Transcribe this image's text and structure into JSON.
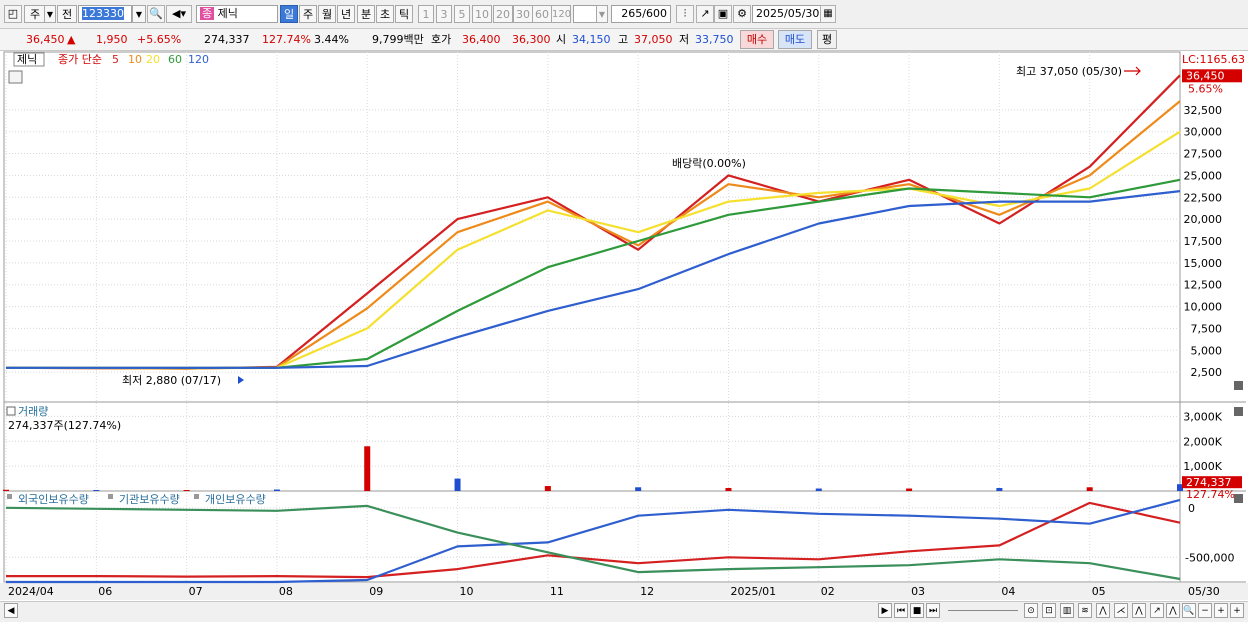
{
  "toolbar": {
    "market_label": "주",
    "prev_label": "전",
    "code": "123330",
    "name_badge": "종",
    "name": "제닉",
    "periods": [
      "일",
      "주",
      "월",
      "년",
      "분",
      "초",
      "틱"
    ],
    "selected_period": "일",
    "intervals": [
      "1",
      "3",
      "5",
      "10",
      "20",
      "30",
      "60",
      "120"
    ],
    "count": "265",
    "count_total": "/600",
    "date": "2025/05/30"
  },
  "quote": {
    "price": "36,450",
    "change": "1,950",
    "change_pct": "+5.65%",
    "volume": "274,337",
    "volume_pct": "127.74%",
    "turnover": "3.44%",
    "amount": "9,799백만",
    "ask_label": "호가",
    "ask": "36,400",
    "bid": "36,300",
    "open_label": "시",
    "open": "34,150",
    "high_label": "고",
    "high": "37,050",
    "low_label": "저",
    "low": "33,750",
    "buy_label": "매수",
    "sell_label": "매도",
    "eval_label": "평"
  },
  "colors": {
    "up": "#d40000",
    "down": "#1f4fd0",
    "ma5": "#d42020",
    "ma10": "#ee8a1a",
    "ma20": "#f5e030",
    "ma60": "#2e9a3a",
    "ma120": "#2f5fcf",
    "foreign": "#d42020",
    "inst": "#2f5fcf",
    "indiv": "#3a8f5a"
  },
  "price_panel": {
    "legend_name": "제닉",
    "legend_type": "종가 단순",
    "legend_periods": [
      "5",
      "10",
      "20",
      "60",
      "120"
    ],
    "lc_label": "LC:1165.63",
    "last_price_label": "36,450",
    "last_pct_label": "5.65%",
    "high_annotation": "최고 37,050 (05/30)",
    "low_annotation": "최저 2,880 (07/17)",
    "dividend_annotation": "배당락(0.00%)",
    "yticks": [
      "32,500",
      "30,000",
      "27,500",
      "25,000",
      "22,500",
      "20,000",
      "17,500",
      "15,000",
      "12,500",
      "10,000",
      "7,500",
      "5,000",
      "2,500"
    ]
  },
  "volume_panel": {
    "title": "거래량",
    "value_label": "274,337주(127.74%)",
    "last_label": "274,337",
    "last_pct": "127.74%",
    "yticks": [
      "3,000K",
      "2,000K",
      "1,000K"
    ]
  },
  "holdings_panel": {
    "legends": [
      "외국인보유수량",
      "기관보유수량",
      "개인보유수량"
    ],
    "yticks": [
      "0",
      "-500,000"
    ]
  },
  "xaxis": {
    "labels": [
      "2024/04",
      "06",
      "07",
      "08",
      "09",
      "10",
      "11",
      "12",
      "2025/01",
      "02",
      "03",
      "04",
      "05"
    ],
    "last_label": "05/30"
  },
  "chart_data": [
    {
      "type": "line",
      "title": "제닉",
      "ylim": [
        0,
        39000
      ],
      "x": [
        "2024/04",
        "06",
        "07",
        "08",
        "09",
        "10",
        "11",
        "12",
        "2025/01",
        "02",
        "03",
        "04",
        "05",
        "05/30"
      ],
      "series": [
        {
          "name": "5",
          "values": [
            3000,
            2950,
            2900,
            3100,
            11500,
            20000,
            22500,
            16500,
            25000,
            22000,
            24500,
            19500,
            26000,
            36450
          ]
        },
        {
          "name": "10",
          "values": [
            3000,
            2950,
            2920,
            3050,
            9800,
            18500,
            22000,
            17000,
            24000,
            22500,
            24000,
            20500,
            25000,
            33500
          ]
        },
        {
          "name": "20",
          "values": [
            3000,
            2980,
            2950,
            3000,
            7500,
            16500,
            21000,
            18500,
            22000,
            23000,
            23500,
            21500,
            23500,
            30000
          ]
        },
        {
          "name": "60",
          "values": [
            3000,
            3000,
            2980,
            3000,
            4000,
            9500,
            14500,
            17500,
            20500,
            22000,
            23500,
            23000,
            22500,
            24500
          ]
        },
        {
          "name": "120",
          "values": [
            3000,
            3000,
            3000,
            3000,
            3200,
            6500,
            9500,
            12000,
            16000,
            19500,
            21500,
            22000,
            22000,
            23200
          ]
        }
      ],
      "annotations": [
        "최고 37,050 (05/30)",
        "최저 2,880 (07/17)",
        "배당락(0.00%)"
      ]
    },
    {
      "type": "bar",
      "title": "거래량",
      "ylim": [
        0,
        3500
      ],
      "x": [
        "2024/04",
        "06",
        "07",
        "08",
        "09",
        "10",
        "11",
        "12",
        "2025/01",
        "02",
        "03",
        "04",
        "05",
        "05/30"
      ],
      "values": [
        50,
        40,
        40,
        60,
        1800,
        500,
        200,
        150,
        120,
        100,
        100,
        120,
        150,
        274
      ]
    },
    {
      "type": "line",
      "ylim": [
        -750000,
        150000
      ],
      "x": [
        "2024/04",
        "06",
        "07",
        "08",
        "09",
        "10",
        "11",
        "12",
        "2025/01",
        "02",
        "03",
        "04",
        "05",
        "05/30"
      ],
      "series": [
        {
          "name": "외국인보유수량",
          "values": [
            -690000,
            -690000,
            -695000,
            -690000,
            -700000,
            -620000,
            -480000,
            -560000,
            -500000,
            -520000,
            -440000,
            -380000,
            50000,
            -150000
          ]
        },
        {
          "name": "기관보유수량",
          "values": [
            -750000,
            -750000,
            -750000,
            -750000,
            -730000,
            -390000,
            -350000,
            -80000,
            -20000,
            -60000,
            -80000,
            -110000,
            -160000,
            80000
          ]
        },
        {
          "name": "개인보유수량",
          "values": [
            0,
            -10000,
            -20000,
            -30000,
            20000,
            -250000,
            -450000,
            -650000,
            -620000,
            -600000,
            -580000,
            -520000,
            -560000,
            -720000
          ]
        }
      ]
    }
  ]
}
